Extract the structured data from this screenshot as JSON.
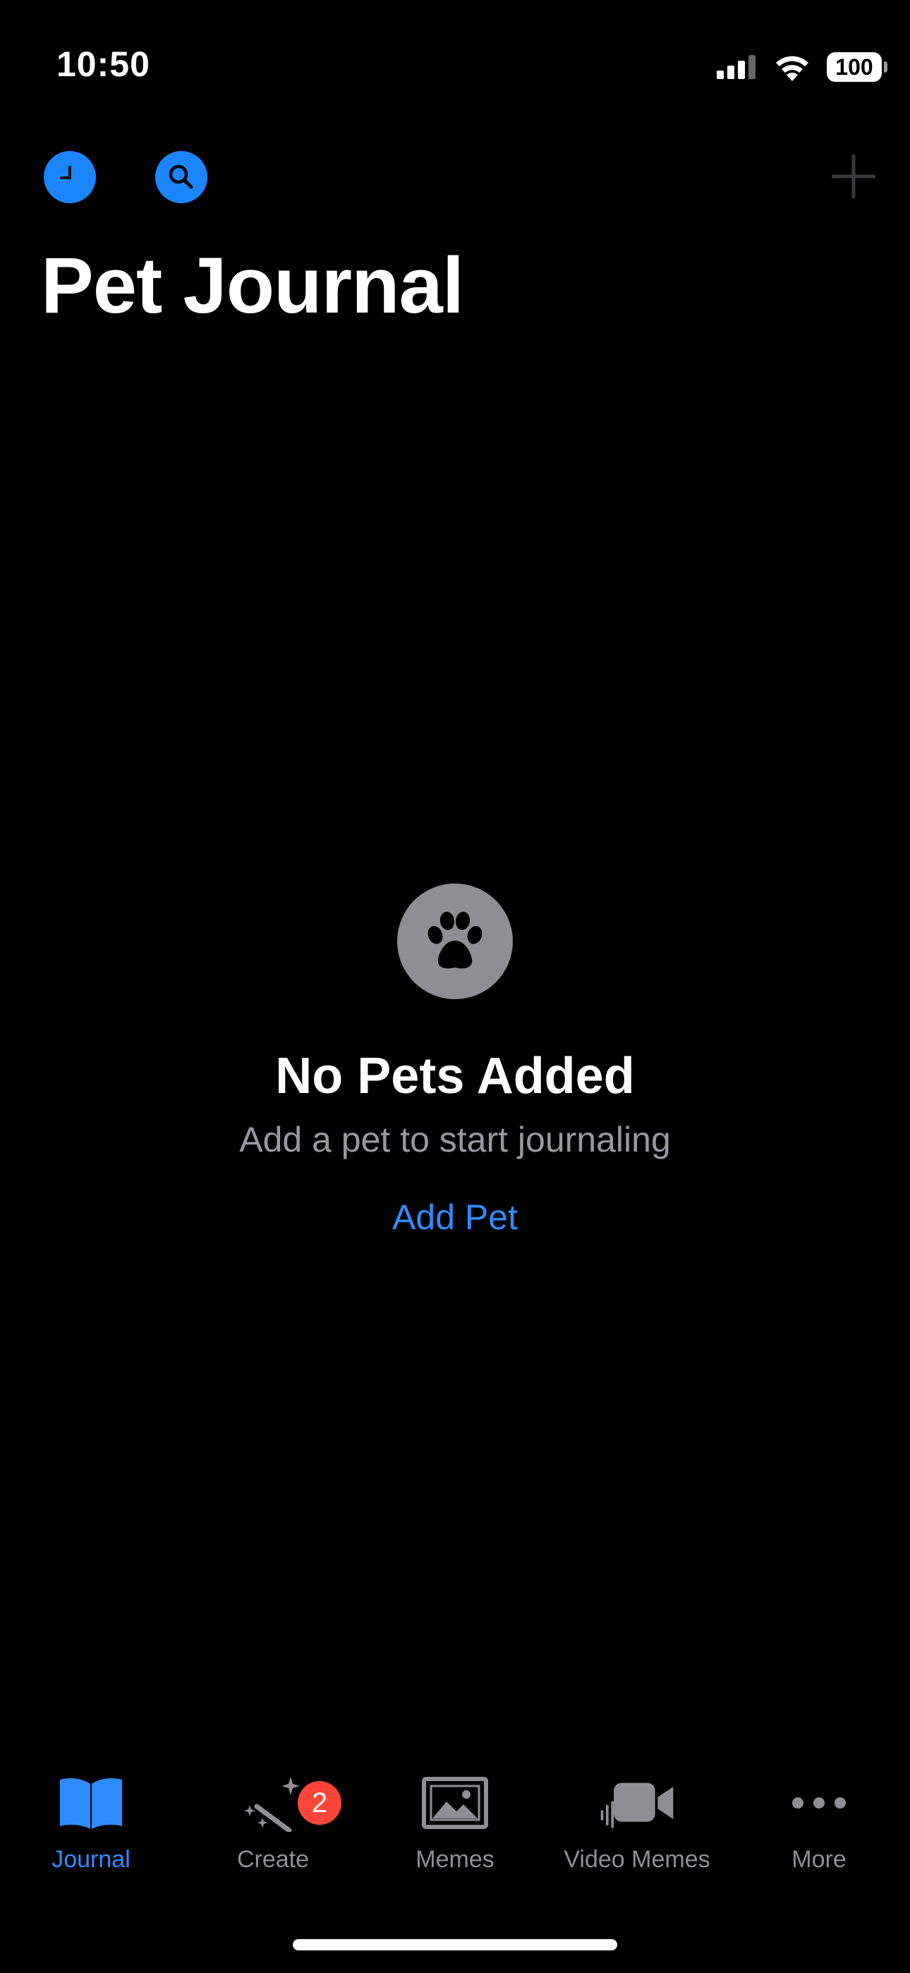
{
  "status": {
    "time": "10:50",
    "battery": "100"
  },
  "header": {
    "title": "Pet Journal"
  },
  "empty_state": {
    "icon": "paw-icon",
    "title": "No Pets Added",
    "subtitle": "Add a pet to start journaling",
    "action": "Add Pet"
  },
  "tabs": [
    {
      "label": "Journal",
      "icon": "book-icon",
      "active": true
    },
    {
      "label": "Create",
      "icon": "magic-wand-icon",
      "badge": "2"
    },
    {
      "label": "Memes",
      "icon": "photo-icon"
    },
    {
      "label": "Video Memes",
      "icon": "video-camera-icon"
    },
    {
      "label": "More",
      "icon": "ellipsis-icon"
    }
  ],
  "colors": {
    "accent": "#1a85ff",
    "link": "#2f8cff",
    "badge": "#ff453a",
    "gray": "#8e8e93"
  }
}
